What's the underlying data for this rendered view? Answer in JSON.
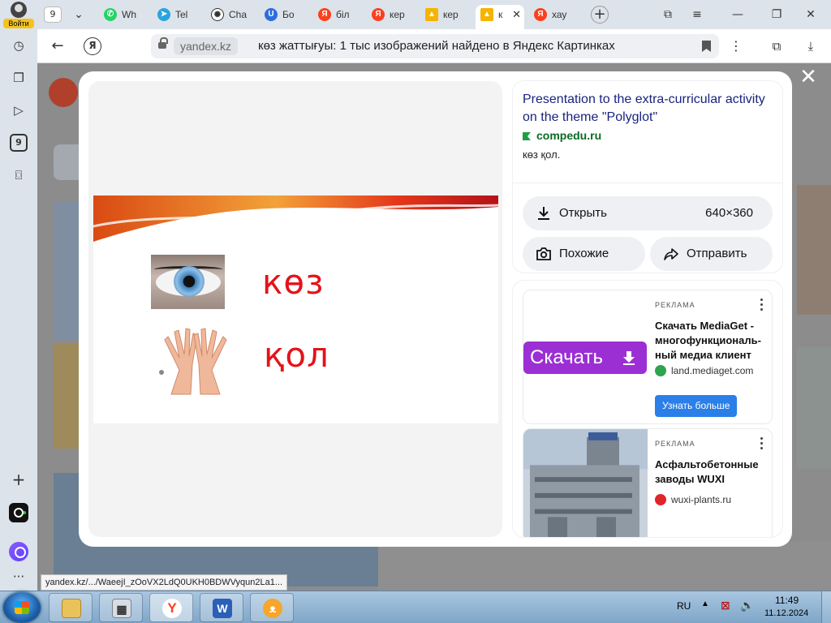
{
  "sidebar": {
    "login_label": "Войти",
    "tab_count_badge": "9"
  },
  "tabs": [
    {
      "label": "Wh",
      "icon": "whatsapp-icon",
      "color": "#25d366"
    },
    {
      "label": "Tel",
      "icon": "telegram-icon",
      "color": "#2aa3df"
    },
    {
      "label": "Cha",
      "icon": "chatgpt-icon",
      "color": "#444444"
    },
    {
      "label": "Бо",
      "icon": "blue-u-icon",
      "color": "#2d6cdf"
    },
    {
      "label": "біл",
      "icon": "yandex-icon",
      "color": "#fc3f1d"
    },
    {
      "label": "кер",
      "icon": "yandex-icon",
      "color": "#fc3f1d"
    },
    {
      "label": "кер",
      "icon": "images-icon",
      "color": "#f5b400"
    },
    {
      "label": "к",
      "icon": "images-icon",
      "color": "#f5b400"
    },
    {
      "label": "хау",
      "icon": "yandex-icon",
      "color": "#fc3f1d"
    }
  ],
  "tab_strip": {
    "tab_count": "9"
  },
  "address": {
    "domain": "yandex.kz",
    "query": "көз жаттығуы: 1 тыс изображений найдено в Яндекс Картинках"
  },
  "viewer": {
    "word1": "көз",
    "word2": "қол"
  },
  "info": {
    "title": "Presentation to the extra-curricular activity on the theme \"Polyglot\"",
    "source": "compedu.ru",
    "description": "көз қол.",
    "open_label": "Открыть",
    "dimensions": "640×360",
    "similar_label": "Похожие",
    "share_label": "Отправить"
  },
  "ads": [
    {
      "tag": "РЕКЛАМА",
      "banner_text": "Скачать",
      "headline": "Скачать MediaGet - многофункциональ-ный медиа клиент",
      "host": "land.mediaget.com",
      "cta": "Узнать больше"
    },
    {
      "tag": "РЕКЛАМА",
      "headline": "Асфальтобетонные заводы WUXI",
      "host": "wuxi-plants.ru"
    }
  ],
  "status_url": "yandex.kz/.../WaeejI_zOoVX2LdQ0UKH0BDWVyqun2La1...",
  "taskbar": {
    "lang": "RU",
    "time": "11:49",
    "date": "11.12.2024",
    "word_label": "W"
  }
}
